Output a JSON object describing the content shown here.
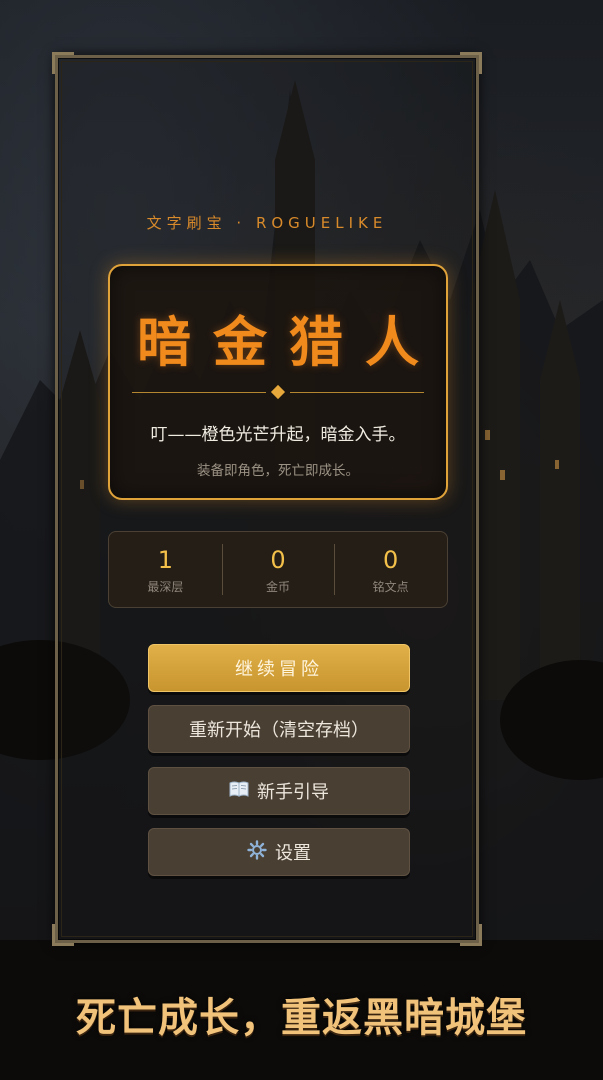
{
  "subtitle": "文字刷宝 · ROGUELIKE",
  "title": "暗金猎人",
  "tagline": "叮——橙色光芒升起，暗金入手。",
  "tagline2": "装备即角色，死亡即成长。",
  "stats": [
    {
      "value": "1",
      "label": "最深层"
    },
    {
      "value": "0",
      "label": "金币"
    },
    {
      "value": "0",
      "label": "铭文点"
    }
  ],
  "buttons": {
    "continue": "继续冒险",
    "restart": "重新开始（清空存档）",
    "guide": "新手引导",
    "settings": "设置"
  },
  "icons": {
    "guide": "book-icon",
    "settings": "gear-icon"
  },
  "slogan": "死亡成长，重返黑暗城堡",
  "colors": {
    "accent": "#f08a1c",
    "gold": "#e0a33a",
    "button_primary": "#d8a53d"
  }
}
